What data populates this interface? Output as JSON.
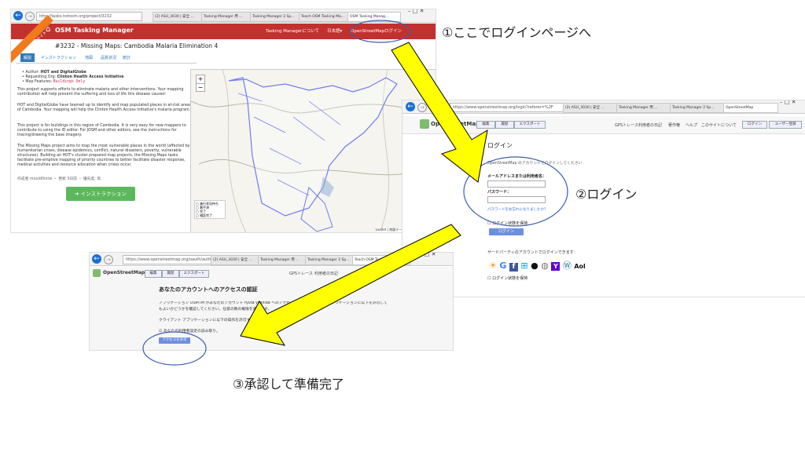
{
  "colors": {
    "arrow": "#ffff00",
    "arrow_stroke": "#000000",
    "circle": "#3a5fb0",
    "tm_red": "#c3312f",
    "tm_green": "#5cb85c",
    "osm_btn": "#6d8fe0",
    "ribbon": "#f07a1c"
  },
  "captions": {
    "step1": "①ここでログインページへ",
    "step2": "②ログイン",
    "step3": "③承認して準備完了"
  },
  "tm": {
    "browser": {
      "url": "http://tasks.hotosm.org/project/3232",
      "tabs": [
        "(2) ASU_3030 | 安全 ...",
        "Tasking Manager 用 ...",
        "Tasking Manager 2 Sp...",
        "Teach OSM Tasking Ma...",
        "OSM Tasking Manag..."
      ]
    },
    "ribbon": "テスト中 本番サイト",
    "logo": "OSM Tasking Manager",
    "header_links": [
      "Tasking Managerについて",
      "日本語▾",
      "OpenStreetMapログイン"
    ],
    "project_title": "#3232 - Missing Maps: Cambodia Malaria Elimination 4",
    "tabs": [
      "解説",
      "インストラクション",
      "地図",
      "品質状況",
      "統計"
    ],
    "meta": [
      {
        "label": "Author:",
        "value": "HOT and DigitalGlobe"
      },
      {
        "label": "Requesting Org:",
        "value": "Clinton Health Access Initiative"
      },
      {
        "label": "Map Features:",
        "value": "Buildings Only"
      }
    ],
    "paragraphs": [
      "This project supports efforts to eliminate malaria and other interventions. Your mapping contribution will help prevent the suffering and loss of life this disease causes!",
      "HOT and DigitalGlobe have teamed up to identify and map populated places in at-risk areas of Cambodia. Your mapping will help the Clinton Health Access Initiative's malaria program.",
      "This project is for buildings in this region of Cambodia. It is very easy for new mappers to contribute to using the iD editor. For JOSM and other editors, see the instructions for tracing/drawing the base imagery.",
      "The Missing Maps project aims to map the most vulnerable places in the world (affected by humanitarian crises, disease epidemics, conflict, natural disasters, poverty, vulnerable structures). Building an HOT's cluster prepared map projects, the Missing Maps tasks facilitate pre-emptive mapping of priority countries to better facilitate disaster response, medical activities and resource allocation when crises occur."
    ],
    "footer_meta": "作成者 mould0nine ・ 更新 3日前 ・ 優先度: 高",
    "instruction_button": "インストラクション",
    "map_legend": [
      "進行状況待ち",
      "着手済",
      "完了",
      "検証完了"
    ],
    "attribution": "Leaflet | 地図データ © OpenStreetMap"
  },
  "login": {
    "browser": {
      "url": "https://www.openstreetmap.org/login?referer=%2F",
      "tabs": [
        "(2) ASU_3030 | 安全 ...",
        "Tasking Manager 用 ...",
        "Tasking Manager 2 Sp...",
        "OpenStreetMap"
      ]
    },
    "logo": "OpenStreetMap",
    "nav": [
      "編集",
      "履歴",
      "エクスポート"
    ],
    "header_links": [
      "GPSトレース",
      "利用者の日記",
      "著作権",
      "ヘルプ",
      "このサイトについて"
    ],
    "header_buttons": [
      "ログイン",
      "ユーザー登録"
    ],
    "title": "ログイン",
    "subtitle": "OpenStreetMap のアカウントでログインしてください",
    "email_label": "メールアドレスまたは利用者名：",
    "password_label": "パスワード：",
    "forgot": "パスワードをお忘れになりましたか？",
    "remember": "ログイン状態を保持",
    "submit": "ログイン",
    "third_party": "サードパーティのアカウントでログインできます：",
    "providers": [
      "OpenID",
      "Google",
      "Facebook",
      "Windows Live",
      "GitHub",
      "Wikipedia",
      "Yahoo",
      "WordPress",
      "Aol"
    ],
    "remember2": "ログイン状態を保持"
  },
  "oauth": {
    "browser": {
      "url": "https://www.openstreetmap.org/oauth/authorize?oauth_token=...",
      "tabs": [
        "(2) ASU_3030 | 安全 ...",
        "Tasking Manager 用 ...",
        "Tasking Manager 2 Sp...",
        "Teach OSM Tasking Ma..."
      ]
    },
    "logo": "OpenStreetMap",
    "nav": [
      "編集",
      "履歴",
      "エクスポート"
    ],
    "header_links": [
      "GPSトレース",
      "利用者の日記"
    ],
    "title": "あなたのアカウントへのアクセスの認証",
    "line1": "アプリケーション OSMTM があなたのアカウント ryuta yoshida へのアクセスを要求しています。アプリケーションに以下を許可して",
    "line2": "もよいかどうかを確認してください。任意の数の権限を選べます。",
    "line3": "クライアント アプリケーションに以下の操作を許可する：",
    "checkbox": "あなたの利用者設定の読み取り。",
    "grant": "アクセスを許可"
  }
}
